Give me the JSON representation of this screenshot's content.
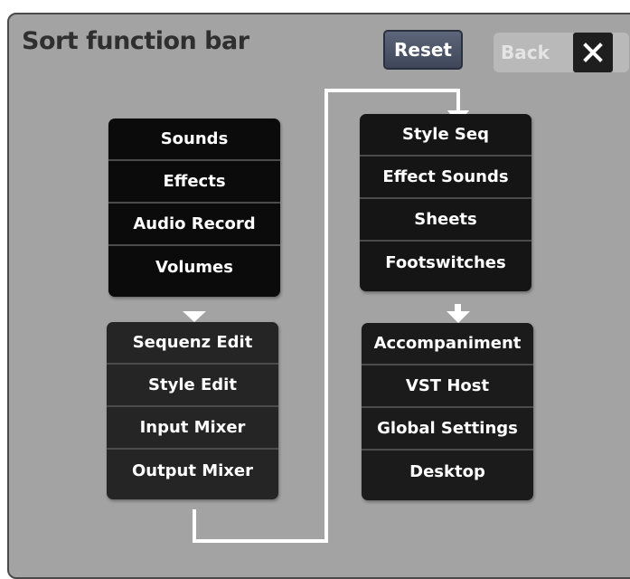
{
  "dialog": {
    "title": "Sort function bar",
    "reset_label": "Reset",
    "back_label": "Back",
    "close_icon": "close-icon"
  },
  "groups": [
    {
      "items": [
        {
          "label": "Sounds"
        },
        {
          "label": "Effects"
        },
        {
          "label": "Audio Record"
        },
        {
          "label": "Volumes"
        }
      ]
    },
    {
      "items": [
        {
          "label": "Sequenz Edit"
        },
        {
          "label": "Style Edit"
        },
        {
          "label": "Input Mixer"
        },
        {
          "label": "Output Mixer"
        }
      ]
    },
    {
      "items": [
        {
          "label": "Style Seq"
        },
        {
          "label": "Effect Sounds"
        },
        {
          "label": "Sheets"
        },
        {
          "label": "Footswitches"
        }
      ]
    },
    {
      "items": [
        {
          "label": "Accompaniment"
        },
        {
          "label": "VST Host"
        },
        {
          "label": "Global Settings"
        },
        {
          "label": "Desktop"
        }
      ]
    }
  ],
  "colors": {
    "panel": "#a3a3a3",
    "button_bg": "#000000",
    "connector": "#ffffff"
  }
}
